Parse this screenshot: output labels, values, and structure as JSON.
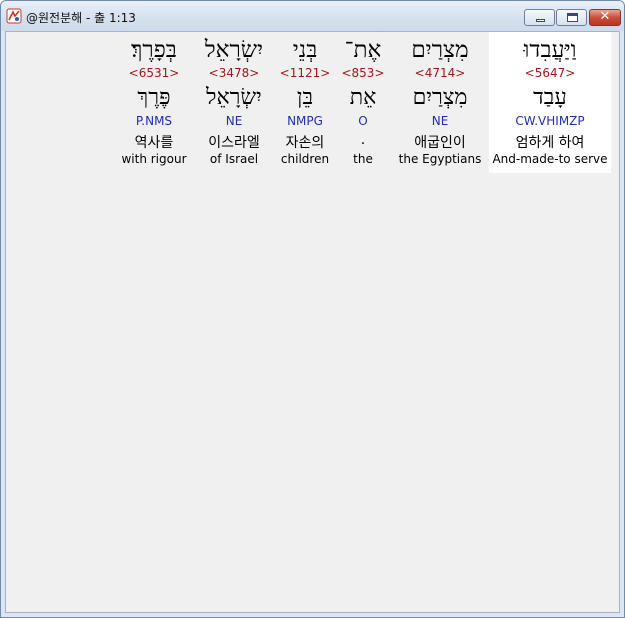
{
  "window": {
    "title": "@원전분해 - 출 1:13",
    "buttons": {
      "minimize": "minimize",
      "maximize": "maximize",
      "close": "✕"
    }
  },
  "words": [
    {
      "hebrew": "וַיַּעֲבִדוּ",
      "strongs": "<5647>",
      "root": "עָבַד",
      "parse": "CW.VHIMZP",
      "korean": "엄하게 하여",
      "english": "And-made-to serve",
      "selected": true
    },
    {
      "hebrew": "מִצְרַיִם",
      "strongs": "<4714>",
      "root": "מִצְרַיִם",
      "parse": "NE",
      "korean": "애굽인이",
      "english": "the Egyptians",
      "selected": false
    },
    {
      "hebrew": "אֶת־",
      "strongs": "<853>",
      "root": "אֵת",
      "parse": "O",
      "korean": ".",
      "english": "the",
      "selected": false
    },
    {
      "hebrew": "בְּנֵי",
      "strongs": "<1121>",
      "root": "בֵּן",
      "parse": "NMPG",
      "korean": "자손의",
      "english": "children",
      "selected": false
    },
    {
      "hebrew": "יִשְׂרָאֵל",
      "strongs": "<3478>",
      "root": "יִשְׂרָאֵל",
      "parse": "NE",
      "korean": "이스라엘",
      "english": "of Israel",
      "selected": false
    },
    {
      "hebrew": "בְּפָרֶךְ׃",
      "strongs": "<6531>",
      "root": "פֶּרֶךְ",
      "parse": "P.NMS",
      "korean": "역사를",
      "english": "with rigour",
      "selected": false
    }
  ]
}
